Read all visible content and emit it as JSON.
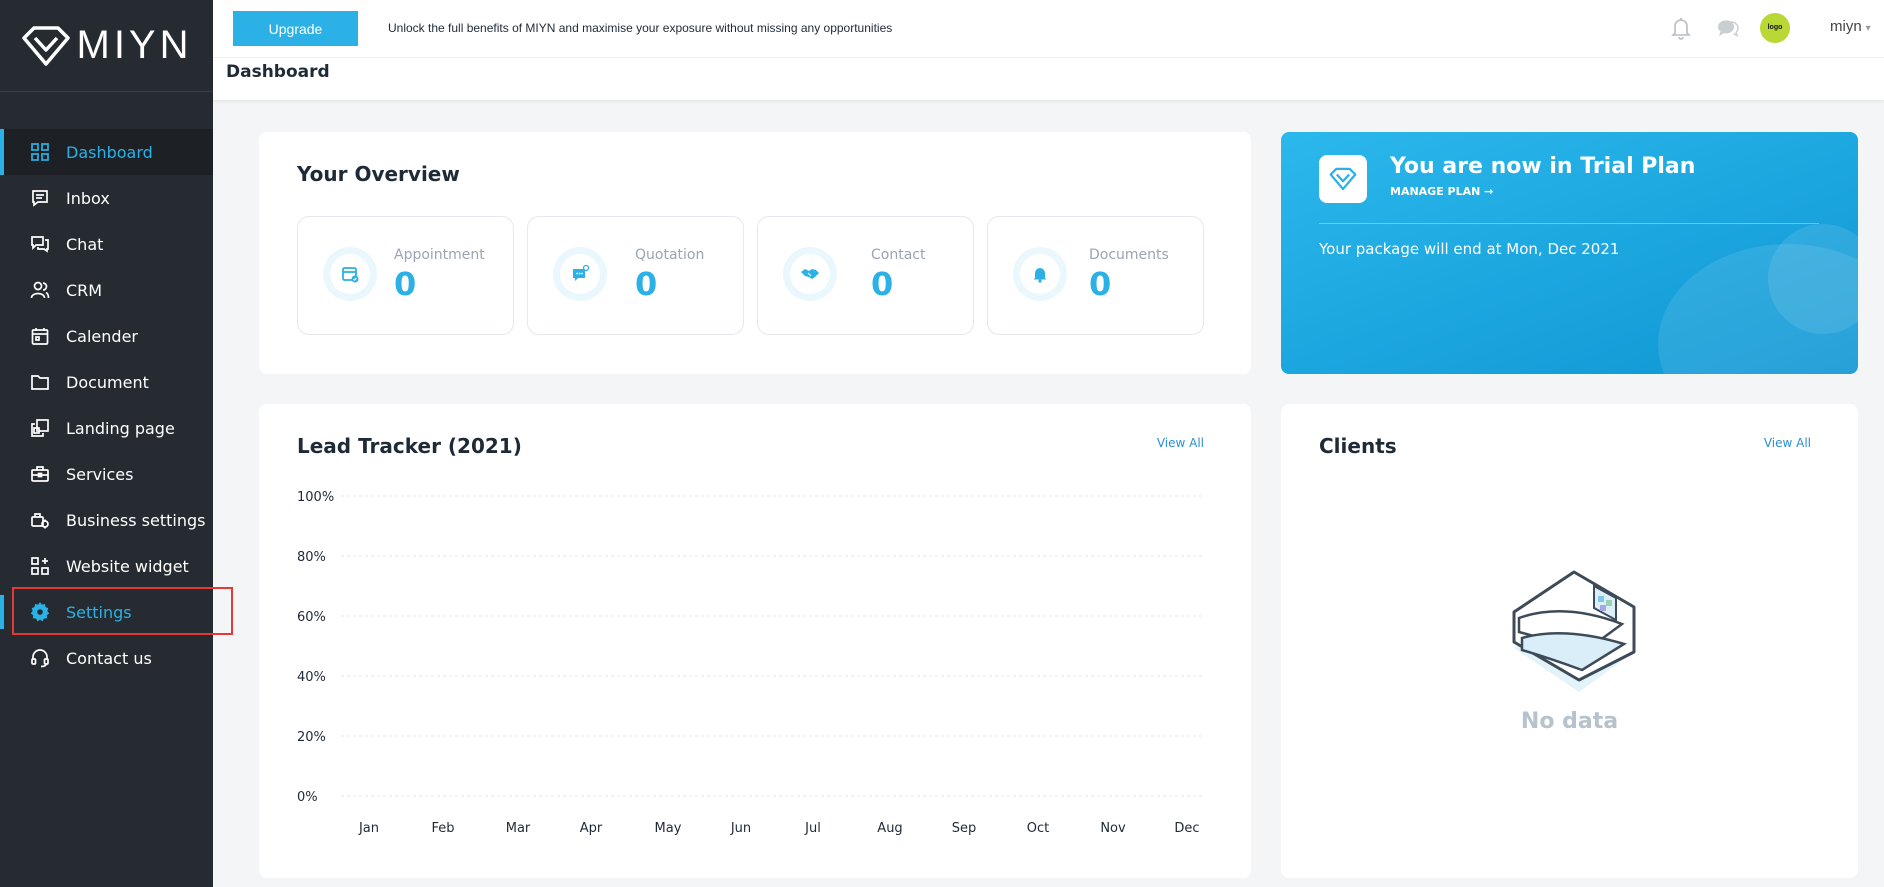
{
  "brand": {
    "name": "MIYN"
  },
  "topbar": {
    "upgrade_label": "Upgrade",
    "promo_text": "Unlock the full benefits of MIYN and maximise your exposure without missing any opportunities",
    "avatar_text": "logo",
    "username": "miyn"
  },
  "page": {
    "title": "Dashboard"
  },
  "sidebar": {
    "items": [
      {
        "label": "Dashboard",
        "icon": "grid-icon"
      },
      {
        "label": "Inbox",
        "icon": "message-icon"
      },
      {
        "label": "Chat",
        "icon": "chat-icon"
      },
      {
        "label": "CRM",
        "icon": "users-icon"
      },
      {
        "label": "Calender",
        "icon": "calendar-icon"
      },
      {
        "label": "Document",
        "icon": "folder-icon"
      },
      {
        "label": "Landing page",
        "icon": "pages-icon"
      },
      {
        "label": "Services",
        "icon": "briefcase-icon"
      },
      {
        "label": "Business settings",
        "icon": "business-settings-icon"
      },
      {
        "label": "Website widget",
        "icon": "widget-icon"
      },
      {
        "label": "Settings",
        "icon": "gear-icon"
      },
      {
        "label": "Contact us",
        "icon": "headset-icon"
      }
    ]
  },
  "overview": {
    "title": "Your Overview",
    "stats": [
      {
        "label": "Appointment",
        "value": "0",
        "icon": "calendar-check-icon"
      },
      {
        "label": "Quotation",
        "value": "0",
        "icon": "quote-chat-icon"
      },
      {
        "label": "Contact",
        "value": "0",
        "icon": "handshake-icon"
      },
      {
        "label": "Documents",
        "value": "0",
        "icon": "bell-icon"
      }
    ]
  },
  "trial": {
    "title": "You are now in Trial Plan",
    "manage_label": "MANAGE PLAN →",
    "end_text": "Your package will end at Mon, Dec 2021"
  },
  "lead_tracker": {
    "title": "Lead Tracker (2021)",
    "view_all": "View All"
  },
  "clients": {
    "title": "Clients",
    "view_all": "View All",
    "empty_text": "No data"
  },
  "colors": {
    "accent": "#2bb1e6",
    "sidebar": "#262b31",
    "highlight": "#e53935"
  },
  "chart_data": {
    "type": "line",
    "categories": [
      "Jan",
      "Feb",
      "Mar",
      "Apr",
      "May",
      "Jun",
      "Jul",
      "Aug",
      "Sep",
      "Oct",
      "Nov",
      "Dec"
    ],
    "y_ticks": [
      "100%",
      "80%",
      "60%",
      "40%",
      "20%",
      "0%"
    ],
    "series": [],
    "ylim": [
      0,
      100
    ],
    "grid": true
  }
}
